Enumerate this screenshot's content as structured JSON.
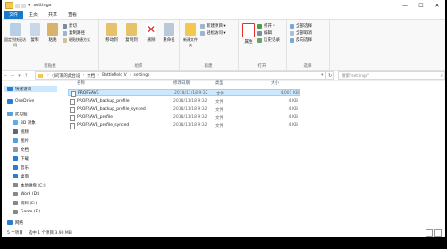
{
  "window": {
    "title": "settings",
    "controls": [
      "—",
      "☐",
      "✕"
    ]
  },
  "ribbon_tabs": [
    "文件",
    "主页",
    "共享",
    "查看"
  ],
  "ribbon": {
    "clipboard": {
      "label": "剪贴板",
      "pin": "固定到快速访问",
      "copy": "复制",
      "paste": "粘贴",
      "cut": "剪切",
      "copy_path": "复制路径",
      "paste_shortcut": "粘贴快捷方式"
    },
    "organize": {
      "label": "组织",
      "move_to": "移动到",
      "copy_to": "复制到",
      "delete": "删除",
      "rename": "重命名"
    },
    "new": {
      "label": "新建",
      "new_folder": "新建文件夹",
      "new_item": "新建项目 ▾",
      "easy_access": "轻松访问 ▾"
    },
    "open": {
      "label": "打开",
      "properties": "属性",
      "open": "打开 ▾",
      "edit": "编辑",
      "history": "历史记录"
    },
    "select": {
      "label": "选择",
      "select_all": "全部选择",
      "select_none": "全部取消",
      "invert": "反向选择"
    }
  },
  "address": {
    "path": [
      "小町家的此台设",
      "文档",
      "Battlefield V",
      "settings"
    ],
    "search_placeholder": "搜索\"settings\""
  },
  "sidebar": [
    {
      "label": "快速访问",
      "icon": "star-icon",
      "color": "#2b7cd3"
    },
    {
      "label": "OneDrive",
      "icon": "cloud-icon",
      "color": "#2b7cd3"
    },
    {
      "label": "此电脑",
      "icon": "computer-icon",
      "color": "#5a9fd6"
    },
    {
      "label": "3D 对象",
      "icon": "cube-icon",
      "color": "#5ab0e8"
    },
    {
      "label": "视频",
      "icon": "video-icon",
      "color": "#5a6a7a"
    },
    {
      "label": "图片",
      "icon": "picture-icon",
      "color": "#5a9fd6"
    },
    {
      "label": "文档",
      "icon": "document-icon",
      "color": "#8a9aab"
    },
    {
      "label": "下载",
      "icon": "download-icon",
      "color": "#2b7cd3"
    },
    {
      "label": "音乐",
      "icon": "music-icon",
      "color": "#2b7cd3"
    },
    {
      "label": "桌面",
      "icon": "desktop-icon",
      "color": "#2b7cd3"
    },
    {
      "label": "本地磁盘 (C:)",
      "icon": "drive-icon",
      "color": "#888888"
    },
    {
      "label": "Work (D:)",
      "icon": "drive-icon",
      "color": "#888888"
    },
    {
      "label": "资料 (E:)",
      "icon": "drive-icon",
      "color": "#888888"
    },
    {
      "label": "Game (F:)",
      "icon": "drive-icon",
      "color": "#888888"
    },
    {
      "label": "网络",
      "icon": "network-icon",
      "color": "#2b7cd3"
    }
  ],
  "columns": {
    "name": "名称",
    "date": "修改日期",
    "type": "类型",
    "size": "大小"
  },
  "files": [
    {
      "name": "PROFSAVE",
      "date": "2018/11/18 9:32",
      "type": "文件",
      "size": "4,001 KB"
    },
    {
      "name": "PROFSAVE_backup_profile",
      "date": "2018/11/18 9:32",
      "type": "文件",
      "size": "4 KB"
    },
    {
      "name": "PROFSAVE_backup_profile_synced",
      "date": "2018/11/18 9:32",
      "type": "文件",
      "size": "4 KB"
    },
    {
      "name": "PROFSAVE_profile",
      "date": "2018/11/18 9:32",
      "type": "文件",
      "size": "4 KB"
    },
    {
      "name": "PROFSAVE_profile_synced",
      "date": "2018/11/18 9:32",
      "type": "文件",
      "size": "4 KB"
    }
  ],
  "status": {
    "count": "5 个项目",
    "selected": "选中 1 个项目 3.90 MB"
  },
  "colors": {
    "accent": "#1979ca",
    "selection": "#cce8ff"
  }
}
